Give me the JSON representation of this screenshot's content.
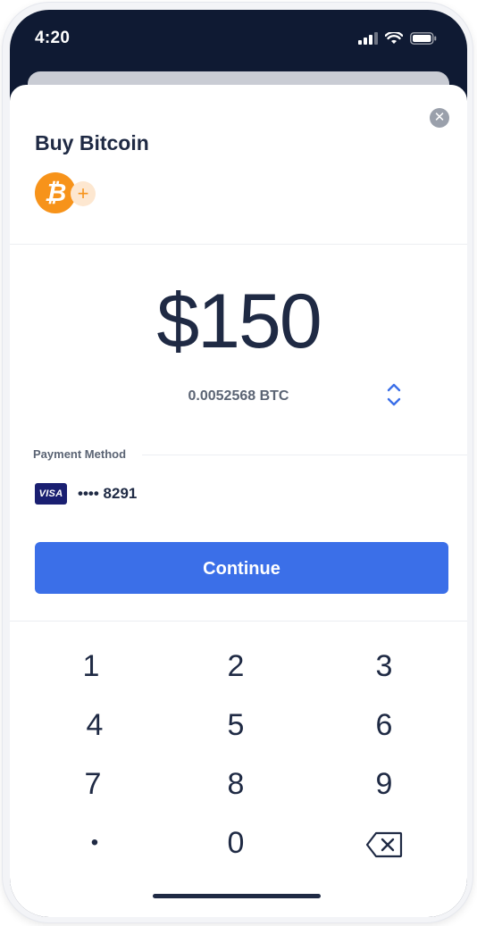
{
  "status_bar": {
    "time": "4:20",
    "icons": [
      "signal-icon",
      "wifi-icon",
      "battery-icon"
    ]
  },
  "sheet": {
    "title": "Buy Bitcoin",
    "close_icon": "close-icon",
    "asset_icon": "bitcoin-icon",
    "asset_symbol": "₿",
    "add_asset_symbol": "+",
    "amount": "$150",
    "converted_amount": "0.0052568 BTC",
    "swap_icon": "swap-vertical-icon",
    "payment_method": {
      "label": "Payment Method",
      "brand": "VISA",
      "card_number": "•••• 8291"
    },
    "continue_label": "Continue"
  },
  "keypad": {
    "keys": [
      {
        "label": "1"
      },
      {
        "label": "2"
      },
      {
        "label": "3"
      },
      {
        "label": "4"
      },
      {
        "label": "5"
      },
      {
        "label": "6"
      },
      {
        "label": "7"
      },
      {
        "label": "8"
      },
      {
        "label": "9"
      },
      {
        "label": "•"
      },
      {
        "label": "0"
      },
      {
        "label": "",
        "icon": "backspace-icon"
      }
    ]
  },
  "colors": {
    "accent": "#3b6fe8",
    "bitcoin": "#f7931a",
    "header": "#0f1a33",
    "text": "#1f2a44"
  }
}
